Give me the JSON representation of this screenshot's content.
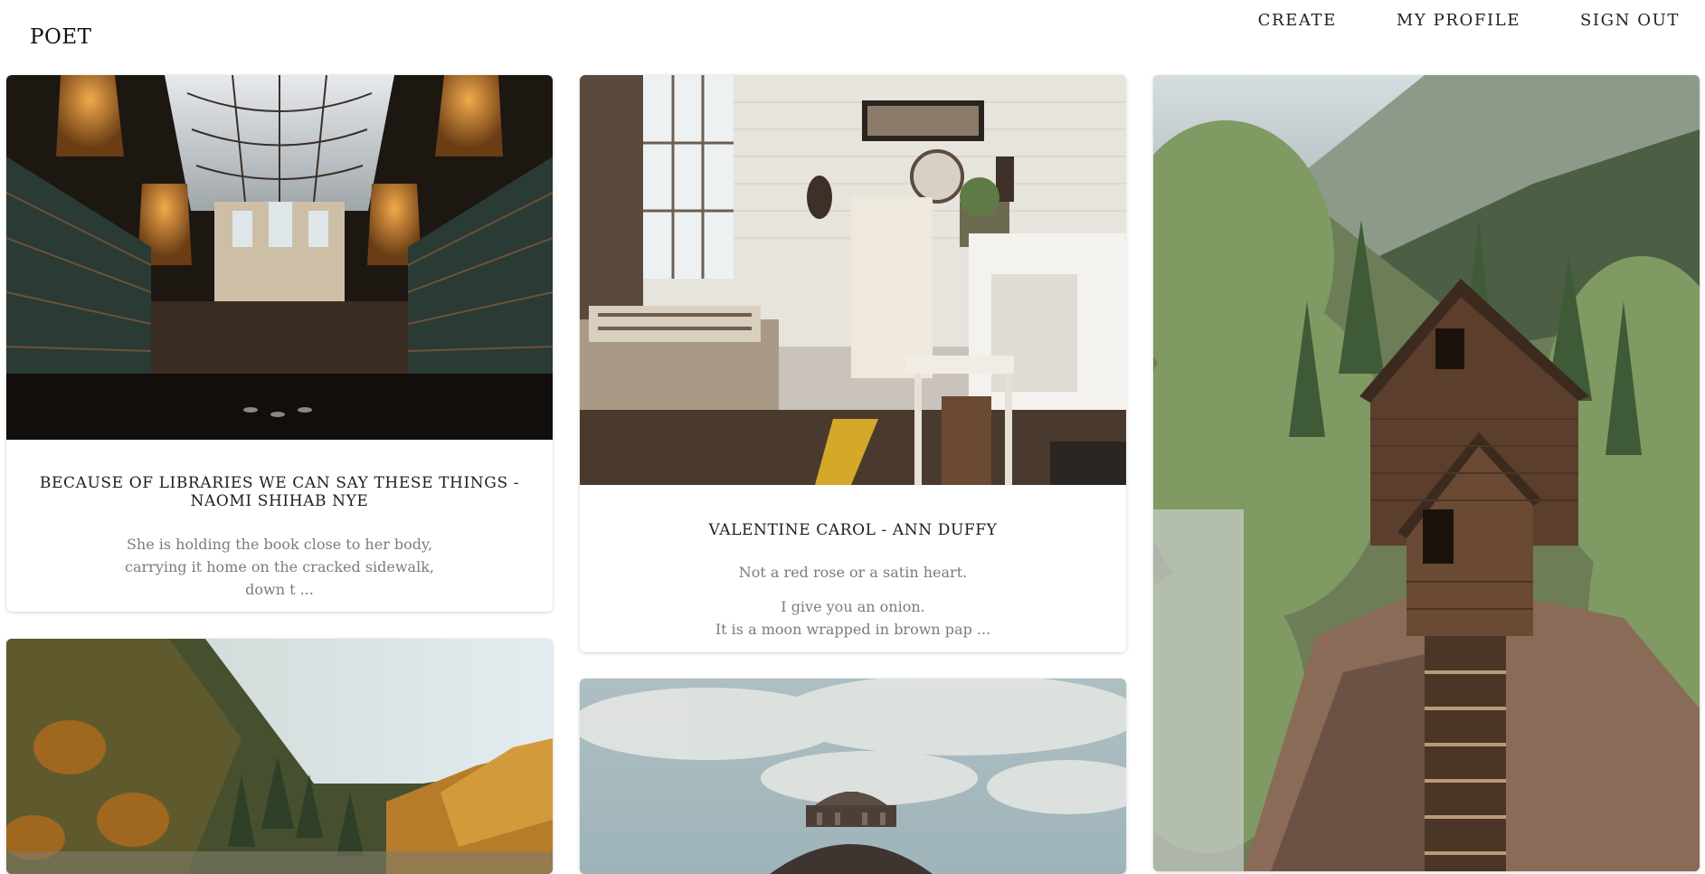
{
  "header": {
    "logo": "POET",
    "nav": {
      "create": "CREATE",
      "my_profile": "MY PROFILE",
      "sign_out": "SIGN OUT"
    }
  },
  "cards": [
    {
      "title": "BECAUSE OF LIBRARIES WE CAN SAY THESE THINGS - NAOMI SHIHAB NYE",
      "excerpt": [
        "She is holding the book close to her body,",
        "carrying it home on the cracked sidewalk,",
        "down t ..."
      ],
      "image": "library-interior-image"
    },
    {
      "title": "VALENTINE CAROL - ANN DUFFY",
      "excerpt_p1": "Not a red rose or a satin heart.",
      "excerpt_p2": [
        "I give you an onion.",
        "It is a moon wrapped in brown pap ..."
      ],
      "image": "antique-shop-interior-image"
    },
    {
      "image": "cliffside-mill-image"
    },
    {
      "image": "autumn-river-forest-image"
    },
    {
      "image": "ornate-dome-sky-image"
    }
  ],
  "colors": {
    "background": "#ffffff",
    "title_text": "#1e1e1e",
    "excerpt_text": "#7c7c7c"
  }
}
